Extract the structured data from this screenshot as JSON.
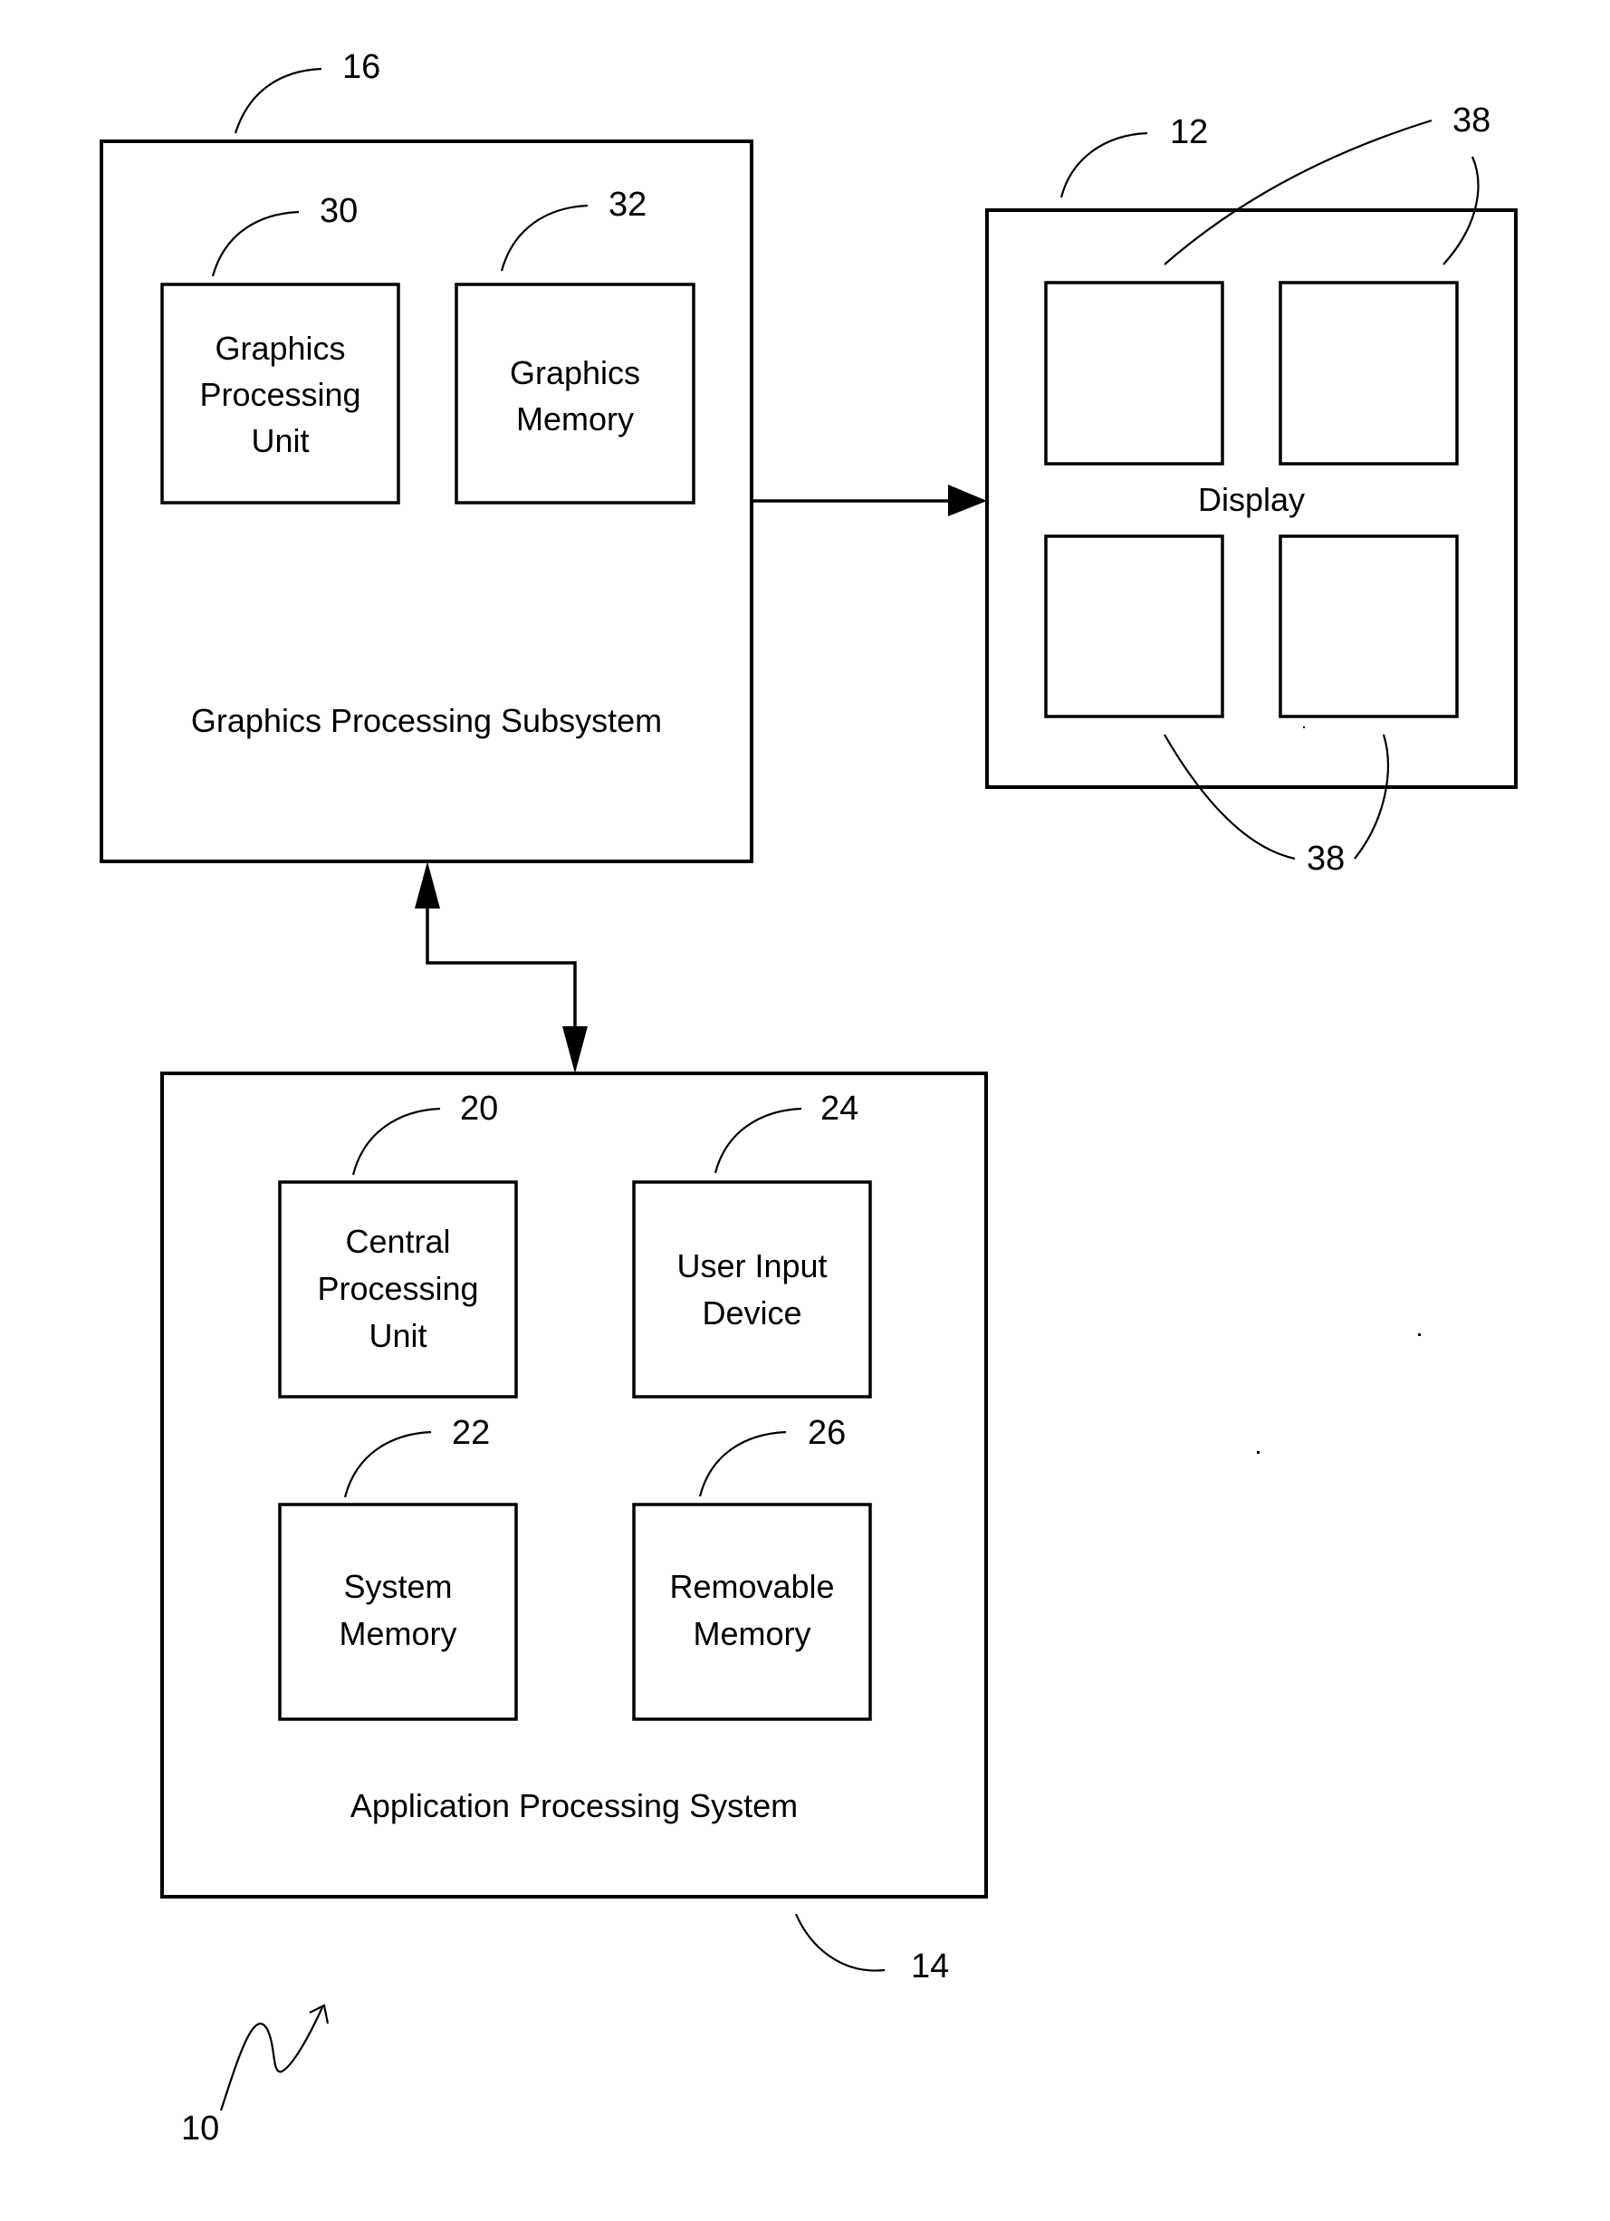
{
  "figure": {
    "system_ref": "10",
    "colors": {
      "ink": "#000000",
      "paper": "#ffffff"
    }
  },
  "graphics_subsystem": {
    "ref": "16",
    "title": "Graphics Processing Subsystem",
    "gpu": {
      "ref": "30",
      "lines": [
        "Graphics",
        "Processing",
        "Unit"
      ]
    },
    "graphics_memory": {
      "ref": "32",
      "lines": [
        "Graphics",
        "Memory"
      ]
    }
  },
  "display": {
    "ref": "12",
    "title": "Display",
    "region_ref": "38",
    "region_count": 4
  },
  "application_system": {
    "ref": "14",
    "title": "Application Processing System",
    "cpu": {
      "ref": "20",
      "lines": [
        "Central",
        "Processing",
        "Unit"
      ]
    },
    "user_input": {
      "ref": "24",
      "lines": [
        "User Input",
        "Device"
      ]
    },
    "system_memory": {
      "ref": "22",
      "lines": [
        "System",
        "Memory"
      ]
    },
    "removable_memory": {
      "ref": "26",
      "lines": [
        "Removable",
        "Memory"
      ]
    }
  },
  "connections": [
    {
      "from": "Graphics Processing Subsystem",
      "to": "Display",
      "direction": "one-way"
    },
    {
      "from": "Graphics Processing Subsystem",
      "to": "Application Processing System",
      "direction": "two-way"
    }
  ]
}
